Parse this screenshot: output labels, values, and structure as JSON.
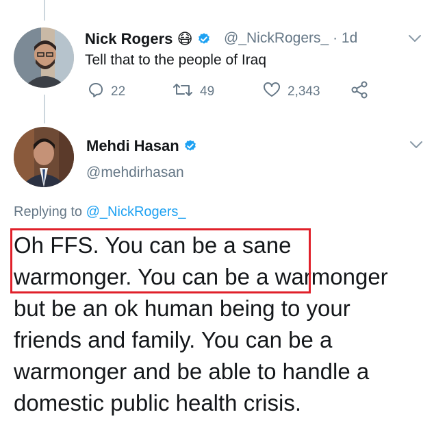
{
  "reply_tweet": {
    "display_name": "Nick Rogers",
    "emoji": "😷",
    "handle": "@_NickRogers_",
    "separator": "·",
    "time": "1d",
    "text": "Tell that to the people of Iraq",
    "actions": {
      "replies": "22",
      "retweets": "49",
      "likes": "2,343"
    }
  },
  "main_tweet": {
    "display_name": "Mehdi Hasan",
    "handle": "@mehdirhasan",
    "replying_prefix": "Replying to",
    "replying_to": "@_NickRogers_",
    "lines": [
      "Oh FFS. You can be a sane",
      "warmonger. You can be a warmonger",
      "but be an ok human being to your",
      "friends and family. You can be a",
      "warmonger and be able to handle a",
      "domestic public health crisis."
    ]
  },
  "colors": {
    "text": "#14171a",
    "secondary": "#657786",
    "accent": "#1da1f2",
    "highlight_box": "#e0202a",
    "thread_line": "#ccd6dd"
  },
  "icons": [
    "reply-icon",
    "retweet-icon",
    "like-icon",
    "share-icon",
    "verified-badge-icon",
    "chevron-down-icon"
  ]
}
